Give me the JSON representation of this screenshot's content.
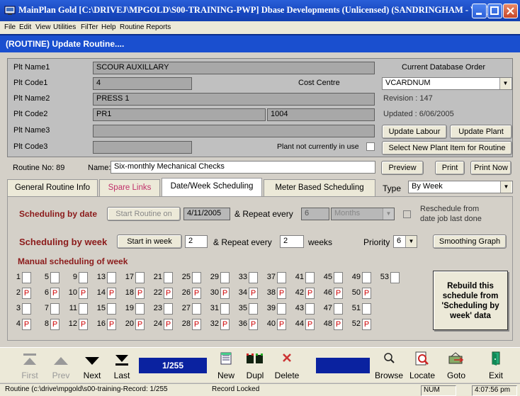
{
  "window": {
    "title": "MainPlan Gold  [C:\\DRIVEJ\\MPGOLD\\S00-TRAINING-PWP]  Dbase Developments (Unlicensed)  (SANDRINGHAM - VIC)"
  },
  "menu": [
    "File",
    "Edit",
    "View",
    "Utilities",
    "FilTer",
    "Help",
    "Routine Reports"
  ],
  "form_title": "(ROUTINE)  Update Routine....",
  "plant": {
    "name1_label": "Plt Name1",
    "name1_value": "SCOUR AUXILLARY",
    "code1_label": "Plt Code1",
    "code1_value": "4",
    "cost_centre_label": "Cost Centre",
    "name2_label": "Plt Name2",
    "name2_value": "PRESS 1",
    "code2_label": "Plt Code2",
    "code2_value": "PR1",
    "code2_extra": "1004",
    "name3_label": "Plt Name3",
    "code3_label": "Plt Code3",
    "not_in_use_label": "Plant not currently in use"
  },
  "database": {
    "order_label": "Current Database Order",
    "order_value": "VCARDNUM",
    "revision": "Revision :  147",
    "updated": "Updated :   6/06/2005",
    "update_labour": "Update Labour",
    "update_plant": "Update Plant",
    "select_new_plant": "Select New Plant Item for Routine"
  },
  "routine": {
    "number": "Routine No: 89",
    "name_label": "Name:",
    "name_value": "Six-monthly Mechanical Checks",
    "preview": "Preview",
    "print": "Print",
    "print_now": "Print Now"
  },
  "tabs": [
    "General Routine Info",
    "Spare Links",
    "Date/Week Scheduling",
    "Meter Based Scheduling"
  ],
  "type": {
    "label": "Type",
    "value": "By Week"
  },
  "by_date": {
    "label": "Scheduling by date",
    "start_btn": "Start Routine on",
    "start_value": "4/11/2005",
    "repeat_label": "& Repeat every",
    "repeat_value": "6",
    "unit": "Months",
    "reschedule_line1": "Reschedule from",
    "reschedule_line2": "date job last done"
  },
  "by_week": {
    "label": "Scheduling by week",
    "start_btn": "Start in week",
    "start_value": "2",
    "repeat_label": "& Repeat every",
    "repeat_value": "2",
    "weeks_label": "weeks",
    "priority_label": "Priority",
    "priority_value": "6",
    "smoothing": "Smoothing Graph"
  },
  "manual": {
    "label": "Manual scheduling of week",
    "rebuild": "Rebuild this schedule from 'Scheduling by week' data",
    "week_mark": "P",
    "rows": [
      {
        "weeks": [
          "1",
          "5",
          "9",
          "13",
          "17",
          "21",
          "25",
          "29",
          "33",
          "37",
          "41",
          "45",
          "49",
          "53"
        ],
        "marked": false
      },
      {
        "weeks": [
          "2",
          "6",
          "10",
          "14",
          "18",
          "22",
          "26",
          "30",
          "34",
          "38",
          "42",
          "46",
          "50"
        ],
        "marked": true
      },
      {
        "weeks": [
          "3",
          "7",
          "11",
          "15",
          "19",
          "23",
          "27",
          "31",
          "35",
          "39",
          "43",
          "47",
          "51"
        ],
        "marked": false
      },
      {
        "weeks": [
          "4",
          "8",
          "12",
          "16",
          "20",
          "24",
          "28",
          "32",
          "36",
          "40",
          "44",
          "48",
          "52"
        ],
        "marked": true
      }
    ]
  },
  "toolbar": {
    "first": "First",
    "prev": "Prev",
    "next": "Next",
    "last": "Last",
    "record": "1/255",
    "new": "New",
    "dupl": "Dupl",
    "delete": "Delete",
    "browse": "Browse",
    "locate": "Locate",
    "goto": "Goto",
    "exit": "Exit"
  },
  "status": {
    "path": "Routine (c:\\drive\\mpgold\\s00-training-Record: 1/255",
    "lock": "Record Locked",
    "num": "NUM",
    "time": "4:07:56 pm"
  }
}
